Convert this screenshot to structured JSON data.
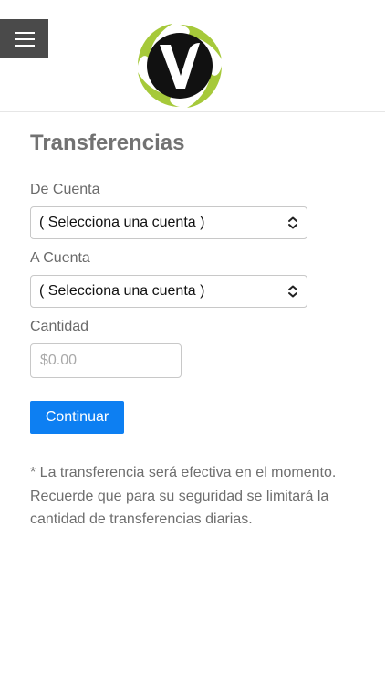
{
  "header": {
    "menu_icon": "hamburger-icon",
    "logo_icon": "v-logo-icon",
    "logo_letter": "V"
  },
  "page": {
    "title": "Transferencias"
  },
  "form": {
    "from_label": "De Cuenta",
    "from_selected": "( Selecciona una cuenta )",
    "to_label": "A Cuenta",
    "to_selected": "( Selecciona una cuenta )",
    "amount_label": "Cantidad",
    "amount_placeholder": "$0.00",
    "amount_value": "",
    "continue_label": "Continuar"
  },
  "note": "* La transferencia será efectiva en el momento. Recuerde que para su seguridad se limitará la cantidad de transferencias diarias.",
  "colors": {
    "primary_button": "#0d7ff2",
    "menu_button": "#4a4a4a",
    "logo_green": "#a6c93a",
    "logo_black": "#111111"
  }
}
